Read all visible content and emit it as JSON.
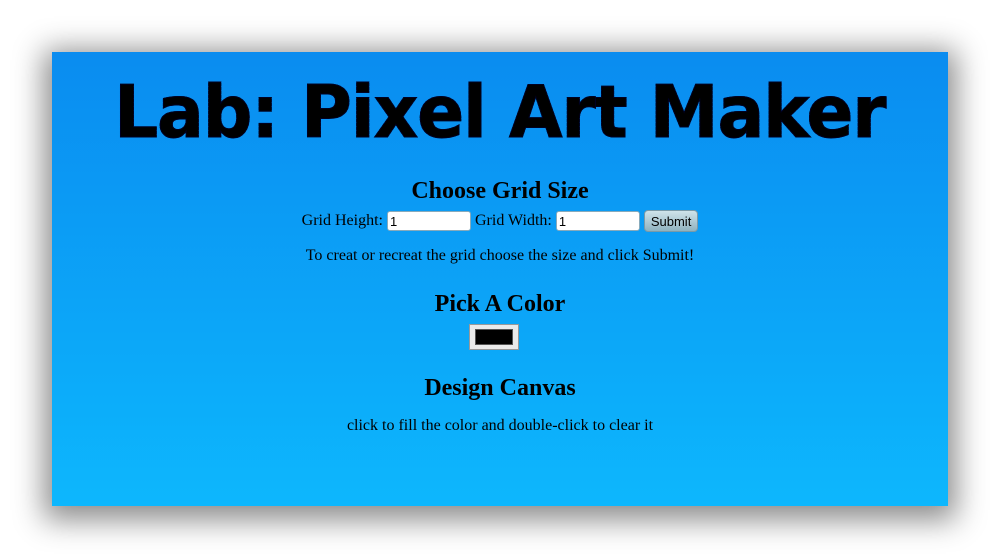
{
  "header": {
    "title": "Lab: Pixel Art Maker"
  },
  "grid_section": {
    "heading": "Choose Grid Size",
    "height_label": "Grid Height:",
    "height_value": "1",
    "width_label": "Grid Width:",
    "width_value": "1",
    "submit_label": "Submit",
    "hint": "To creat or recreat the grid choose the size and click Submit!"
  },
  "color_section": {
    "heading": "Pick A Color",
    "selected_color": "#000000"
  },
  "canvas_section": {
    "heading": "Design Canvas",
    "hint": "click to fill the color and double-click to clear it"
  },
  "colors": {
    "background_top": "#0a8cf0",
    "background_bottom": "#0db7fd"
  }
}
